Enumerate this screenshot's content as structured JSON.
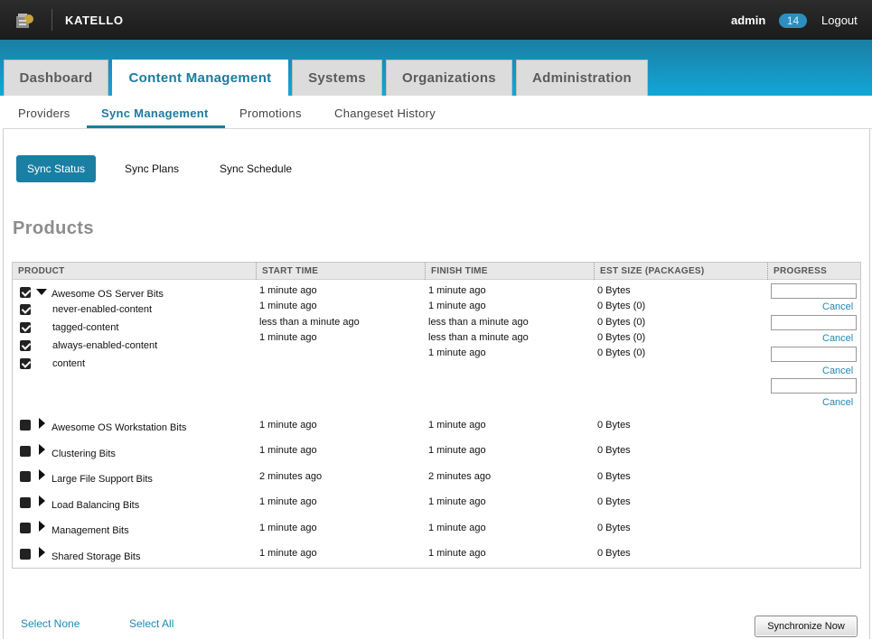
{
  "app": {
    "brand": "KATELLO",
    "user": "admin",
    "notifications": "14",
    "logout": "Logout"
  },
  "main_tabs": [
    "Dashboard",
    "Content Management",
    "Systems",
    "Organizations",
    "Administration"
  ],
  "active_main_tab": "Content Management",
  "sub_tabs": [
    "Providers",
    "Sync Management",
    "Promotions",
    "Changeset History"
  ],
  "active_sub_tab": "Sync Management",
  "pills": [
    "Sync Status",
    "Sync Plans",
    "Sync Schedule"
  ],
  "active_pill": "Sync Status",
  "heading": "Products",
  "columns": [
    "PRODUCT",
    "START TIME",
    "FINISH TIME",
    "EST SIZE (PACKAGES)",
    "PROGRESS"
  ],
  "expanded_product": {
    "name": "Awesome OS Server Bits",
    "checked": true,
    "repos": [
      {
        "name": "never-enabled-content",
        "checked": true
      },
      {
        "name": "tagged-content",
        "checked": true
      },
      {
        "name": "always-enabled-content",
        "checked": true
      },
      {
        "name": "content",
        "checked": true
      }
    ],
    "start_times": [
      "1 minute ago",
      "1 minute ago",
      "less than a minute ago",
      "1 minute ago"
    ],
    "finish_times": [
      "1 minute ago",
      "1 minute ago",
      "less than a minute ago",
      "less than a minute ago",
      "1 minute ago"
    ],
    "sizes": [
      "0 Bytes",
      "0 Bytes (0)",
      "0 Bytes (0)",
      "0 Bytes (0)",
      "0 Bytes (0)"
    ],
    "cancel_label": "Cancel",
    "progress_count": 4
  },
  "products": [
    {
      "name": "Awesome OS Workstation Bits",
      "start": "1 minute ago",
      "finish": "1 minute ago",
      "size": "0 Bytes"
    },
    {
      "name": "Clustering Bits",
      "start": "1 minute ago",
      "finish": "1 minute ago",
      "size": "0 Bytes"
    },
    {
      "name": "Large File Support Bits",
      "start": "2 minutes ago",
      "finish": "2 minutes ago",
      "size": "0 Bytes"
    },
    {
      "name": "Load Balancing Bits",
      "start": "1 minute ago",
      "finish": "1 minute ago",
      "size": "0 Bytes"
    },
    {
      "name": "Management Bits",
      "start": "1 minute ago",
      "finish": "1 minute ago",
      "size": "0 Bytes"
    },
    {
      "name": "Shared Storage Bits",
      "start": "1 minute ago",
      "finish": "1 minute ago",
      "size": "0 Bytes"
    }
  ],
  "footer": {
    "select_none": "Select None",
    "select_all": "Select All",
    "sync_now": "Synchronize Now"
  },
  "colors": {
    "accent": "#1a7fa3",
    "link": "#1c8ab5",
    "topbar": "#1b1b1b"
  }
}
